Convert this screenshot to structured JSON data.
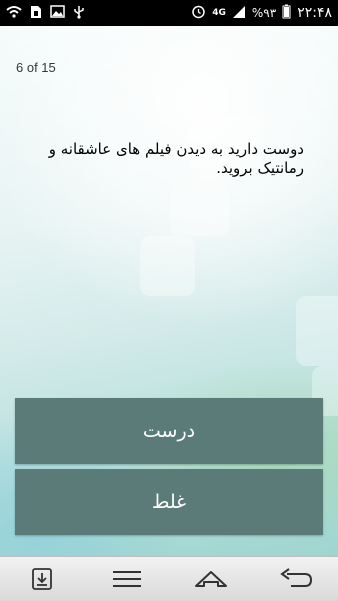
{
  "status_bar": {
    "time": "۲۲:۴۸",
    "battery": "%۹۳",
    "network": "4G",
    "icons_left": [
      "wifi-icon",
      "sim-icon",
      "image-icon",
      "usb-icon"
    ],
    "icons_right": [
      "alarm-icon",
      "signal-icon",
      "battery-icon"
    ]
  },
  "quiz": {
    "progress": "6 of 15",
    "question": "دوست دارید به دیدن فیلم های عاشقانه و رمانتیک بروید.",
    "answer_true": "درست",
    "answer_false": "غلط"
  },
  "navbar": {
    "buttons": [
      "save-icon",
      "menu-icon",
      "home-icon",
      "back-icon"
    ]
  },
  "colors": {
    "button_bg": "#5a7b78",
    "status_bg": "#000000"
  }
}
